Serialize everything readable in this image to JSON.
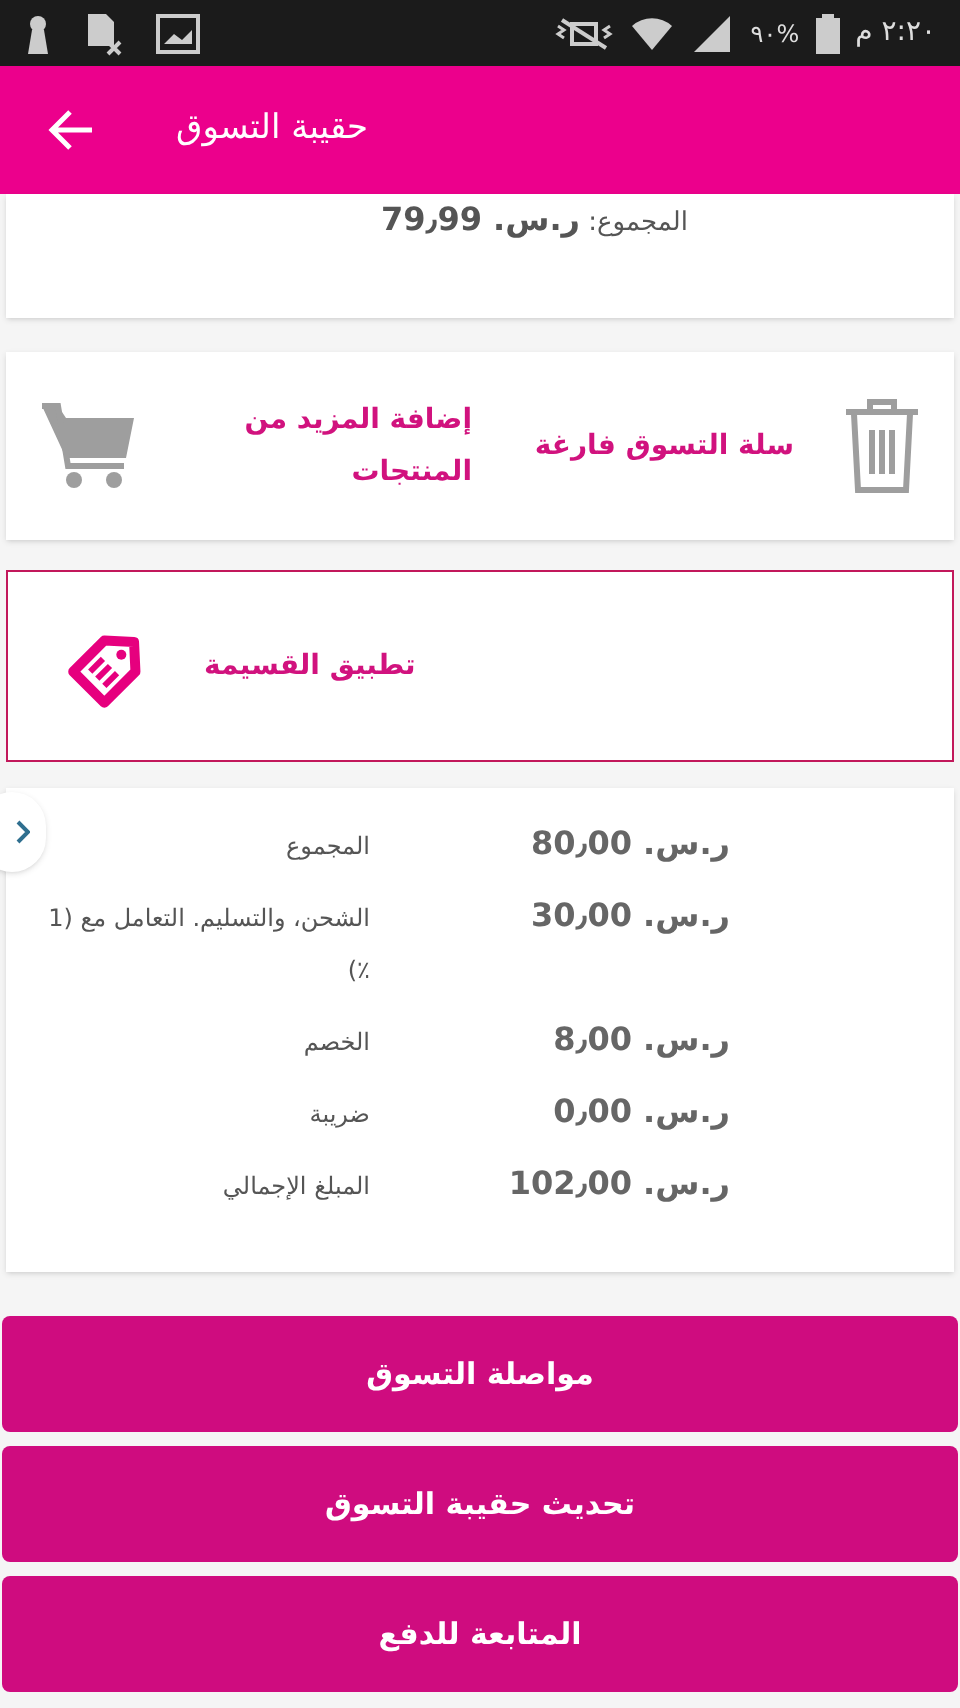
{
  "status_bar": {
    "battery": "٩٠%",
    "time": "٢:٢٠ م"
  },
  "header": {
    "title": "حقيبة التسوق"
  },
  "cart_total": {
    "label": "المجموع:",
    "value": "ر.س. 79٫99"
  },
  "cart_actions": [
    {
      "kind": "clear",
      "label": "سلة التسوق فارغة"
    },
    {
      "kind": "add",
      "label": "إضافة المزيد من المنتجات"
    }
  ],
  "coupon": {
    "label": "تطبيق القسيمة"
  },
  "summary": [
    {
      "label": "المجموع",
      "value": "ر.س. 80٫00"
    },
    {
      "label": "الشحن، والتسليم. التعامل مع (1 ٪)",
      "value": "ر.س. 30٫00"
    },
    {
      "label": "الخصم",
      "value": "ر.س. 8٫00"
    },
    {
      "label": "ضريبة",
      "value": "ر.س. 0٫00"
    },
    {
      "label": "المبلغ الإجمالي",
      "value": "ر.س. 102٫00"
    }
  ],
  "buttons": [
    "مواصلة التسوق",
    "تحديث حقيبة التسوق",
    "المتابعة للدفع"
  ]
}
